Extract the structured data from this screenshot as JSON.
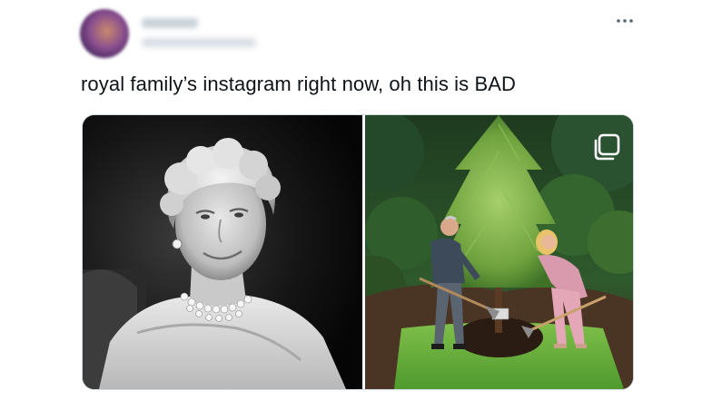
{
  "tweet": {
    "text": "royal family’s instagram right now, oh this is BAD",
    "more_icon": "more-horizontal-icon",
    "avatar": "blurred-avatar"
  },
  "media": {
    "left_photo": "black-and-white-portrait",
    "right_photo": "tree-planting-photo",
    "overlay_icon": "multiple-images-icon"
  }
}
